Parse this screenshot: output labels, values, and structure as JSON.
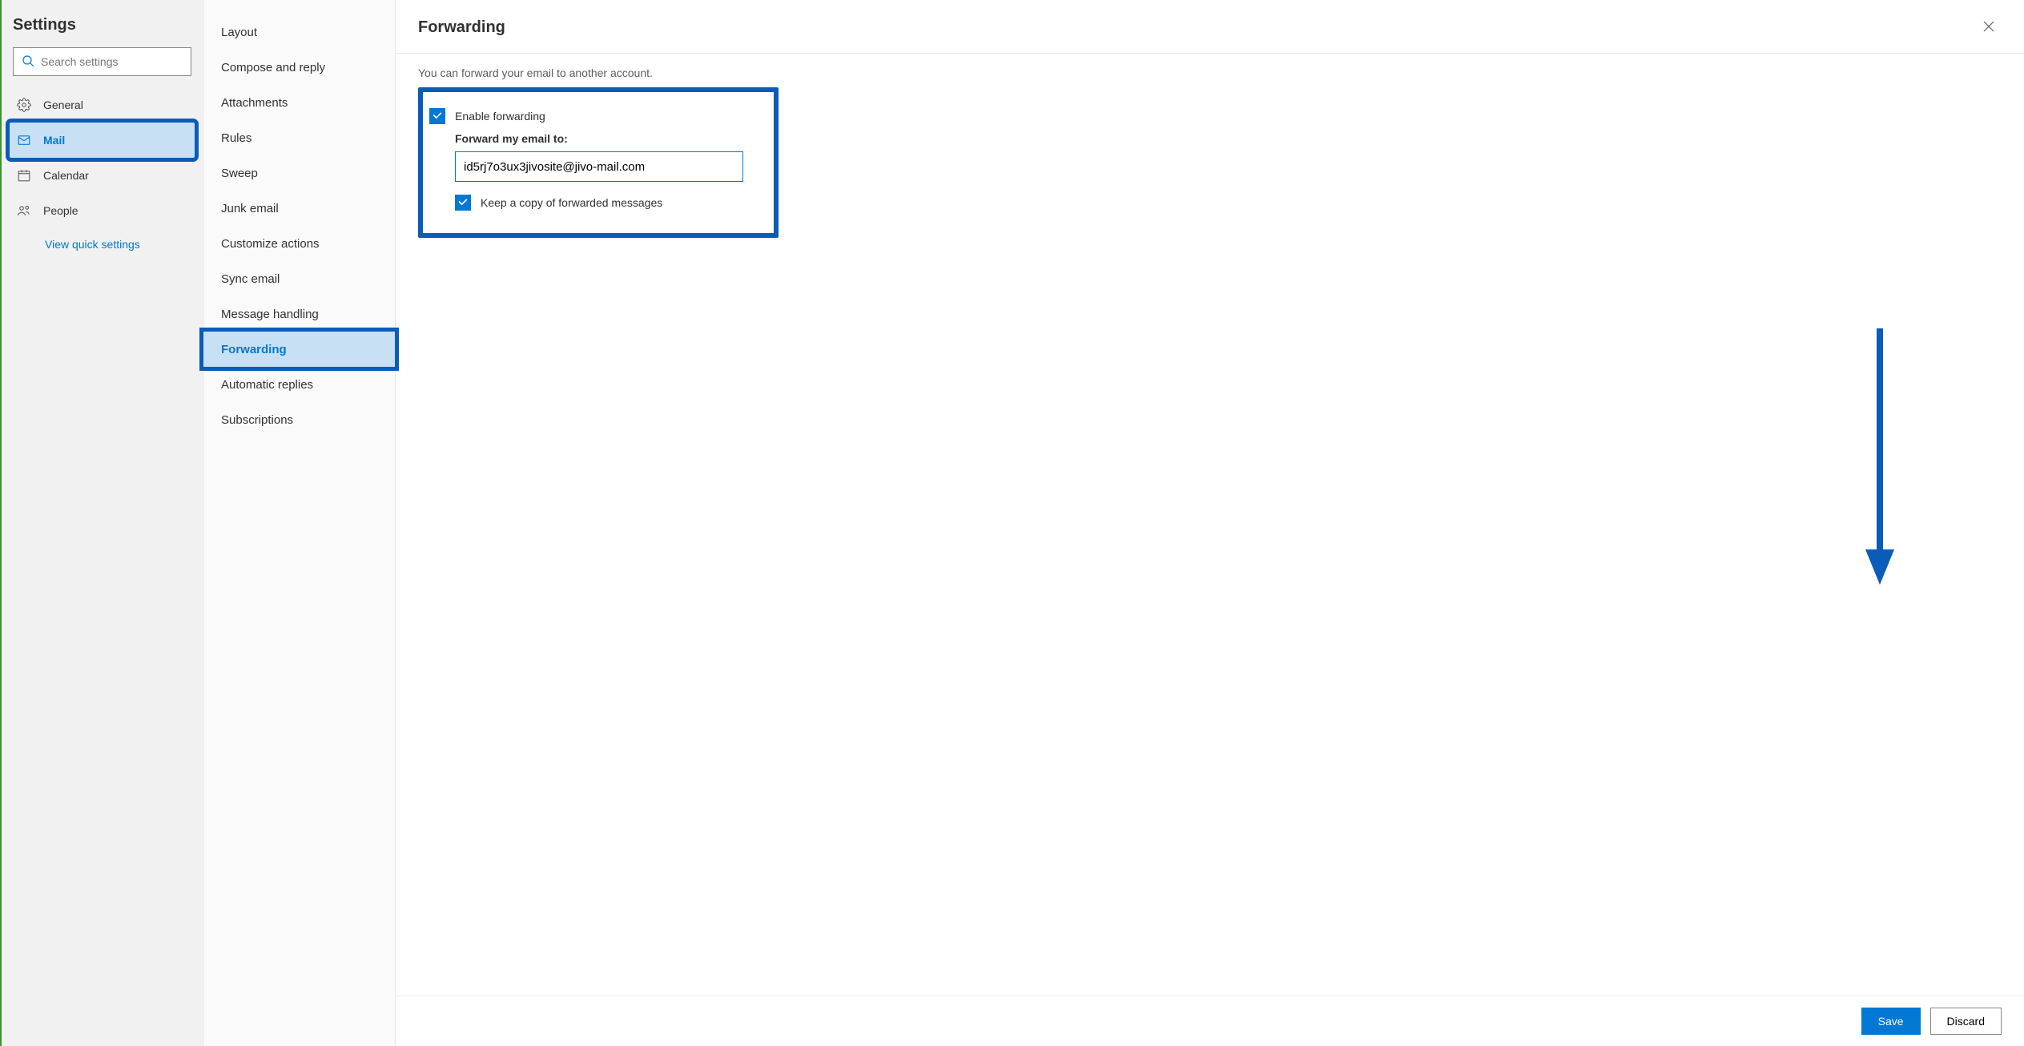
{
  "title": "Settings",
  "search_placeholder": "Search settings",
  "categories": [
    {
      "key": "general",
      "label": "General"
    },
    {
      "key": "mail",
      "label": "Mail"
    },
    {
      "key": "calendar",
      "label": "Calendar"
    },
    {
      "key": "people",
      "label": "People"
    }
  ],
  "quick_settings_link": "View quick settings",
  "sub_settings": [
    "Layout",
    "Compose and reply",
    "Attachments",
    "Rules",
    "Sweep",
    "Junk email",
    "Customize actions",
    "Sync email",
    "Message handling",
    "Forwarding",
    "Automatic replies",
    "Subscriptions"
  ],
  "main": {
    "heading": "Forwarding",
    "intro": "You can forward your email to another account.",
    "enable_label": "Enable forwarding",
    "enable_checked": true,
    "forward_to_label": "Forward my email to:",
    "forward_to_value": "id5rj7o3ux3jivosite@jivo-mail.com",
    "keep_copy_label": "Keep a copy of forwarded messages",
    "keep_copy_checked": true
  },
  "footer": {
    "save": "Save",
    "discard": "Discard"
  }
}
